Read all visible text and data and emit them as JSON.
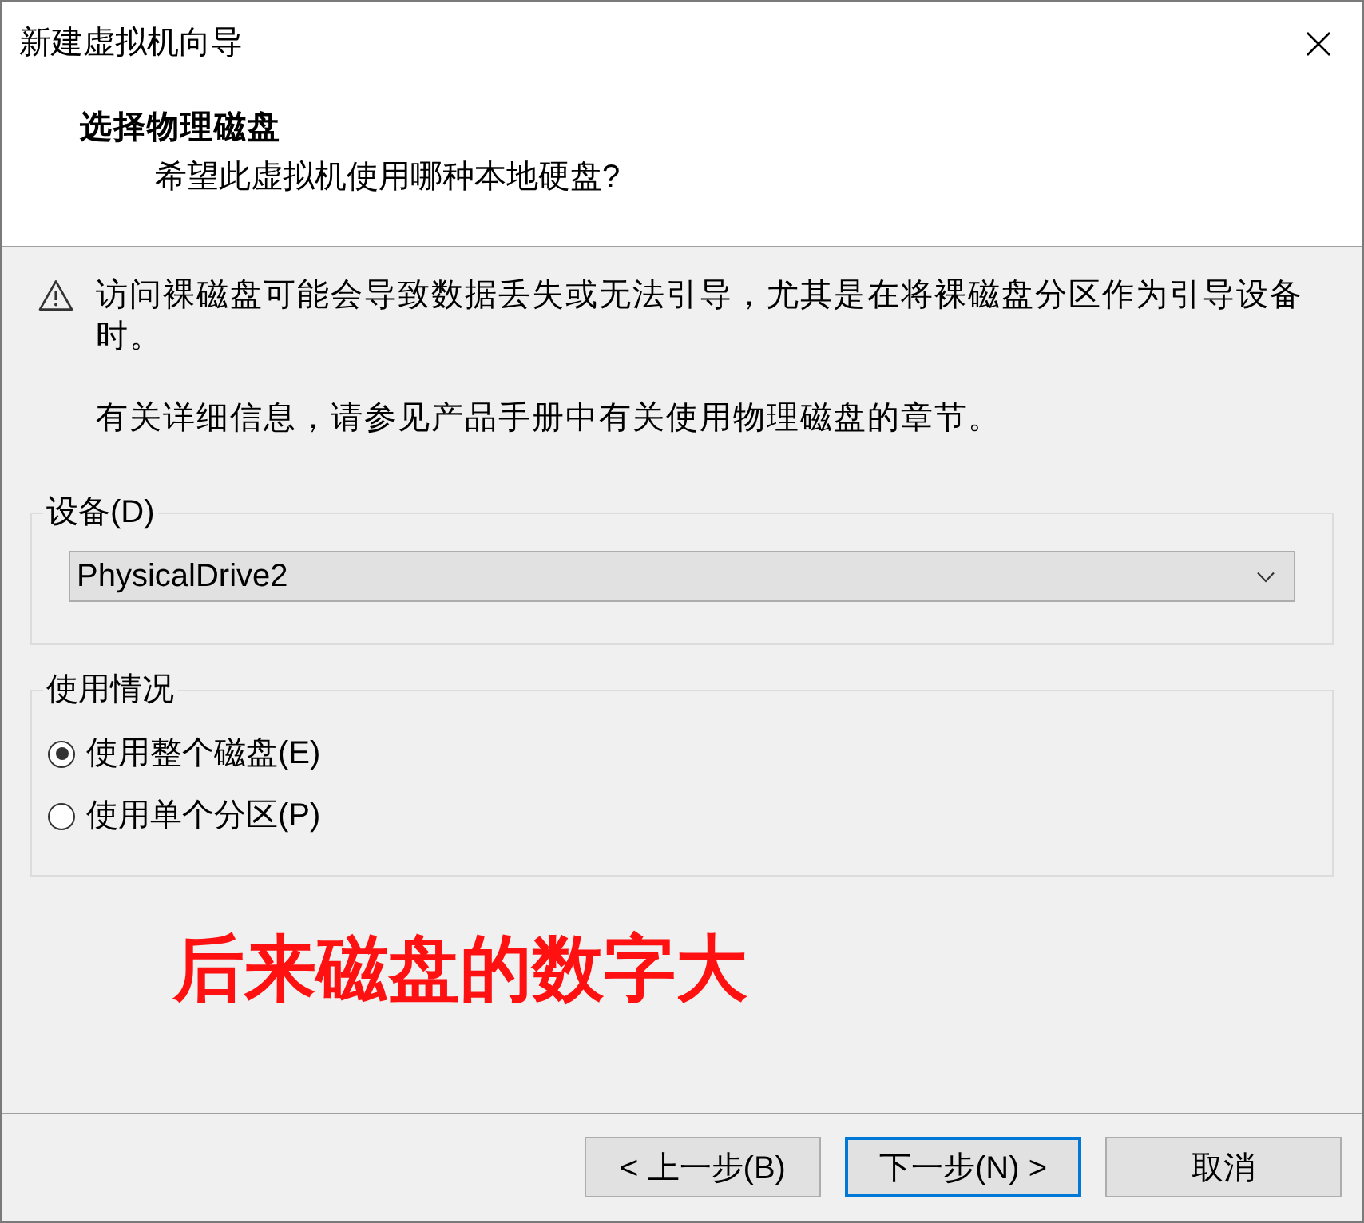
{
  "window": {
    "title": "新建虚拟机向导"
  },
  "header": {
    "title": "选择物理磁盘",
    "subtitle": "希望此虚拟机使用哪种本地硬盘?"
  },
  "warning": {
    "paragraphs": [
      "访问裸磁盘可能会导致数据丢失或无法引导，尤其是在将裸磁盘分区作为引导设备时。",
      "有关详细信息，请参见产品手册中有关使用物理磁盘的章节。"
    ]
  },
  "device_group": {
    "label": "设备(D)",
    "dropdown": {
      "value": "PhysicalDrive2"
    }
  },
  "usage_group": {
    "label": "使用情况",
    "options": [
      {
        "label": "使用整个磁盘(E)",
        "selected": true
      },
      {
        "label": "使用单个分区(P)",
        "selected": false
      }
    ]
  },
  "annotation": "后来磁盘的数字大",
  "buttons": [
    {
      "label": "< 上一步(B)",
      "focused": false
    },
    {
      "label": "下一步(N) >",
      "focused": true
    },
    {
      "label": "取消",
      "focused": false
    }
  ]
}
